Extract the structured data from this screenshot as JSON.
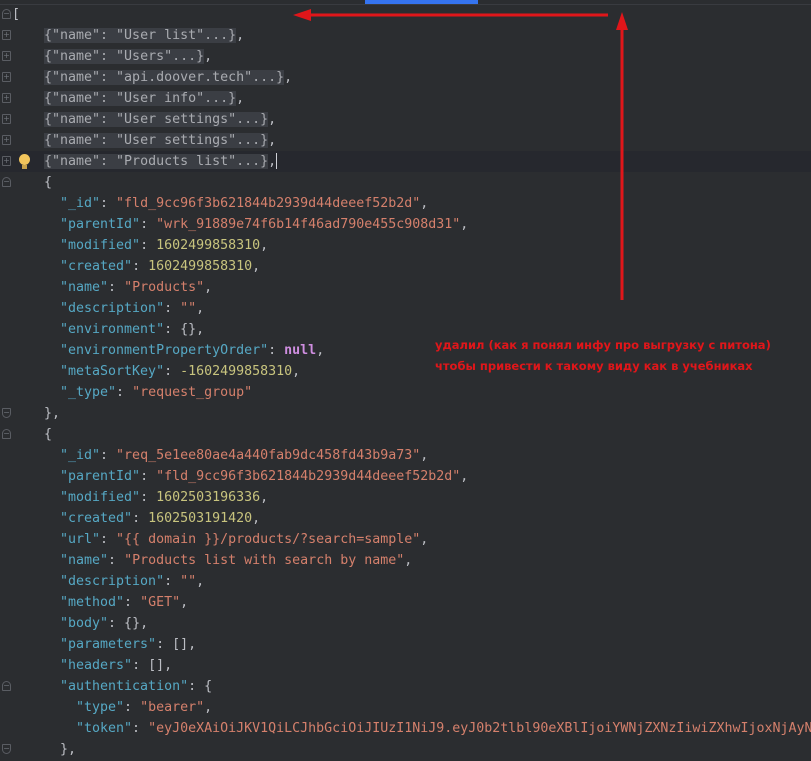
{
  "editor": {
    "current_line": 7,
    "lines": [
      {
        "fold": "open",
        "tokens": [
          [
            "punc",
            "["
          ]
        ]
      },
      {
        "fold": "collapsed",
        "folded": "{\"name\": \"User list\"...}",
        "tokens": [
          [
            "punc",
            ","
          ]
        ]
      },
      {
        "fold": "collapsed",
        "folded": "{\"name\": \"Users\"...}",
        "tokens": [
          [
            "punc",
            ","
          ]
        ]
      },
      {
        "fold": "collapsed",
        "folded": "{\"name\": \"api.doover.tech\"...}",
        "tokens": [
          [
            "punc",
            ","
          ]
        ]
      },
      {
        "fold": "collapsed",
        "folded": "{\"name\": \"User info\"...}",
        "tokens": [
          [
            "punc",
            ","
          ]
        ]
      },
      {
        "fold": "collapsed",
        "folded": "{\"name\": \"User settings\"...}",
        "tokens": [
          [
            "punc",
            ","
          ]
        ]
      },
      {
        "fold": "collapsed",
        "folded": "{\"name\": \"User settings\"...}",
        "tokens": [
          [
            "punc",
            ","
          ]
        ]
      },
      {
        "fold": "collapsed",
        "folded": "{\"name\": \"Products list\"...}",
        "tokens": [
          [
            "punc",
            ","
          ]
        ]
      },
      {
        "fold": "open",
        "tokens": [
          [
            "punc",
            "{"
          ]
        ]
      },
      {
        "tokens": [
          [
            "key",
            "\"_id\""
          ],
          [
            "punc",
            ": "
          ],
          [
            "str",
            "\"fld_9cc96f3b621844b2939d44deeef52b2d\""
          ],
          [
            "punc",
            ","
          ]
        ]
      },
      {
        "tokens": [
          [
            "key",
            "\"parentId\""
          ],
          [
            "punc",
            ": "
          ],
          [
            "str",
            "\"wrk_91889e74f6b14f46ad790e455c908d31\""
          ],
          [
            "punc",
            ","
          ]
        ]
      },
      {
        "tokens": [
          [
            "key",
            "\"modified\""
          ],
          [
            "punc",
            ": "
          ],
          [
            "num",
            "1602499858310"
          ],
          [
            "punc",
            ","
          ]
        ]
      },
      {
        "tokens": [
          [
            "key",
            "\"created\""
          ],
          [
            "punc",
            ": "
          ],
          [
            "num",
            "1602499858310"
          ],
          [
            "punc",
            ","
          ]
        ]
      },
      {
        "tokens": [
          [
            "key",
            "\"name\""
          ],
          [
            "punc",
            ": "
          ],
          [
            "str",
            "\"Products\""
          ],
          [
            "punc",
            ","
          ]
        ]
      },
      {
        "tokens": [
          [
            "key",
            "\"description\""
          ],
          [
            "punc",
            ": "
          ],
          [
            "str",
            "\"\""
          ],
          [
            "punc",
            ","
          ]
        ]
      },
      {
        "tokens": [
          [
            "key",
            "\"environment\""
          ],
          [
            "punc",
            ": {},"
          ]
        ]
      },
      {
        "tokens": [
          [
            "key",
            "\"environmentPropertyOrder\""
          ],
          [
            "punc",
            ": "
          ],
          [
            "null",
            "null"
          ],
          [
            "punc",
            ","
          ]
        ]
      },
      {
        "tokens": [
          [
            "key",
            "\"metaSortKey\""
          ],
          [
            "punc",
            ": "
          ],
          [
            "num",
            "-1602499858310"
          ],
          [
            "punc",
            ","
          ]
        ]
      },
      {
        "tokens": [
          [
            "key",
            "\"_type\""
          ],
          [
            "punc",
            ": "
          ],
          [
            "str",
            "\"request_group\""
          ]
        ]
      },
      {
        "fold": "close",
        "tokens": [
          [
            "punc",
            "},"
          ]
        ]
      },
      {
        "fold": "open",
        "tokens": [
          [
            "punc",
            "{"
          ]
        ]
      },
      {
        "tokens": [
          [
            "key",
            "\"_id\""
          ],
          [
            "punc",
            ": "
          ],
          [
            "str",
            "\"req_5e1ee80ae4a440fab9dc458fd43b9a73\""
          ],
          [
            "punc",
            ","
          ]
        ]
      },
      {
        "tokens": [
          [
            "key",
            "\"parentId\""
          ],
          [
            "punc",
            ": "
          ],
          [
            "str",
            "\"fld_9cc96f3b621844b2939d44deeef52b2d\""
          ],
          [
            "punc",
            ","
          ]
        ]
      },
      {
        "tokens": [
          [
            "key",
            "\"modified\""
          ],
          [
            "punc",
            ": "
          ],
          [
            "num",
            "1602503196336"
          ],
          [
            "punc",
            ","
          ]
        ]
      },
      {
        "tokens": [
          [
            "key",
            "\"created\""
          ],
          [
            "punc",
            ": "
          ],
          [
            "num",
            "1602503191420"
          ],
          [
            "punc",
            ","
          ]
        ]
      },
      {
        "tokens": [
          [
            "key",
            "\"url\""
          ],
          [
            "punc",
            ": "
          ],
          [
            "str",
            "\"{{ domain }}/products/?search=sample\""
          ],
          [
            "punc",
            ","
          ]
        ]
      },
      {
        "tokens": [
          [
            "key",
            "\"name\""
          ],
          [
            "punc",
            ": "
          ],
          [
            "str",
            "\"Products list with search by name\""
          ],
          [
            "punc",
            ","
          ]
        ]
      },
      {
        "tokens": [
          [
            "key",
            "\"description\""
          ],
          [
            "punc",
            ": "
          ],
          [
            "str",
            "\"\""
          ],
          [
            "punc",
            ","
          ]
        ]
      },
      {
        "tokens": [
          [
            "key",
            "\"method\""
          ],
          [
            "punc",
            ": "
          ],
          [
            "str",
            "\"GET\""
          ],
          [
            "punc",
            ","
          ]
        ]
      },
      {
        "tokens": [
          [
            "key",
            "\"body\""
          ],
          [
            "punc",
            ": {},"
          ]
        ]
      },
      {
        "tokens": [
          [
            "key",
            "\"parameters\""
          ],
          [
            "punc",
            ": [],"
          ]
        ]
      },
      {
        "tokens": [
          [
            "key",
            "\"headers\""
          ],
          [
            "punc",
            ": [],"
          ]
        ]
      },
      {
        "fold": "open",
        "tokens": [
          [
            "key",
            "\"authentication\""
          ],
          [
            "punc",
            ": {"
          ]
        ]
      },
      {
        "tokens": [
          [
            "key",
            "\"type\""
          ],
          [
            "punc",
            ": "
          ],
          [
            "str",
            "\"bearer\""
          ],
          [
            "punc",
            ","
          ]
        ]
      },
      {
        "tokens": [
          [
            "key",
            "\"token\""
          ],
          [
            "punc",
            ": "
          ],
          [
            "str",
            "\"eyJ0eXAiOiJKV1QiLCJhbGciOiJIUzI1NiJ9.eyJ0b2tlbl90eXBlIjoiYWNjZXNzIiwiZXhwIjoxNjAyN"
          ]
        ]
      },
      {
        "fold": "close",
        "tokens": [
          [
            "punc",
            "},"
          ]
        ]
      }
    ]
  },
  "annotation": {
    "line1": "удалил (как я понял инфу про выгрузку с питона)",
    "line2": "чтобы привести к такому виду как в учебниках",
    "color": "#e0161a"
  }
}
